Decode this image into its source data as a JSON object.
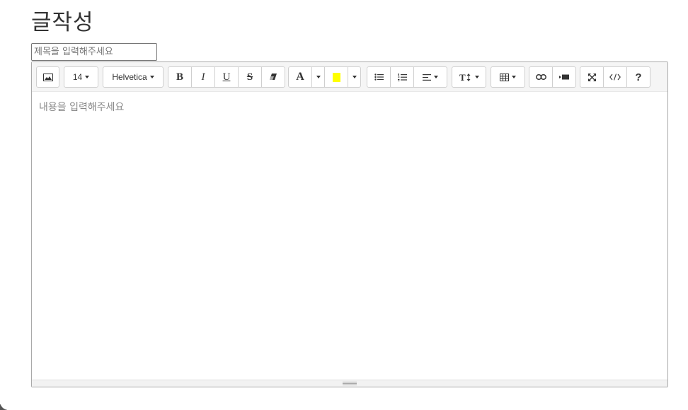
{
  "page": {
    "title": "글작성"
  },
  "form": {
    "title_placeholder": "제목을 입력해주세요"
  },
  "toolbar": {
    "font_size": "14",
    "font_family": "Helvetica",
    "bold": "B",
    "italic": "I",
    "underline": "U",
    "strikethrough": "S",
    "font_color_label": "A",
    "help": "?",
    "highlight_color": "#ffff00"
  },
  "editor": {
    "content_placeholder": "내용을 입력해주세요"
  }
}
